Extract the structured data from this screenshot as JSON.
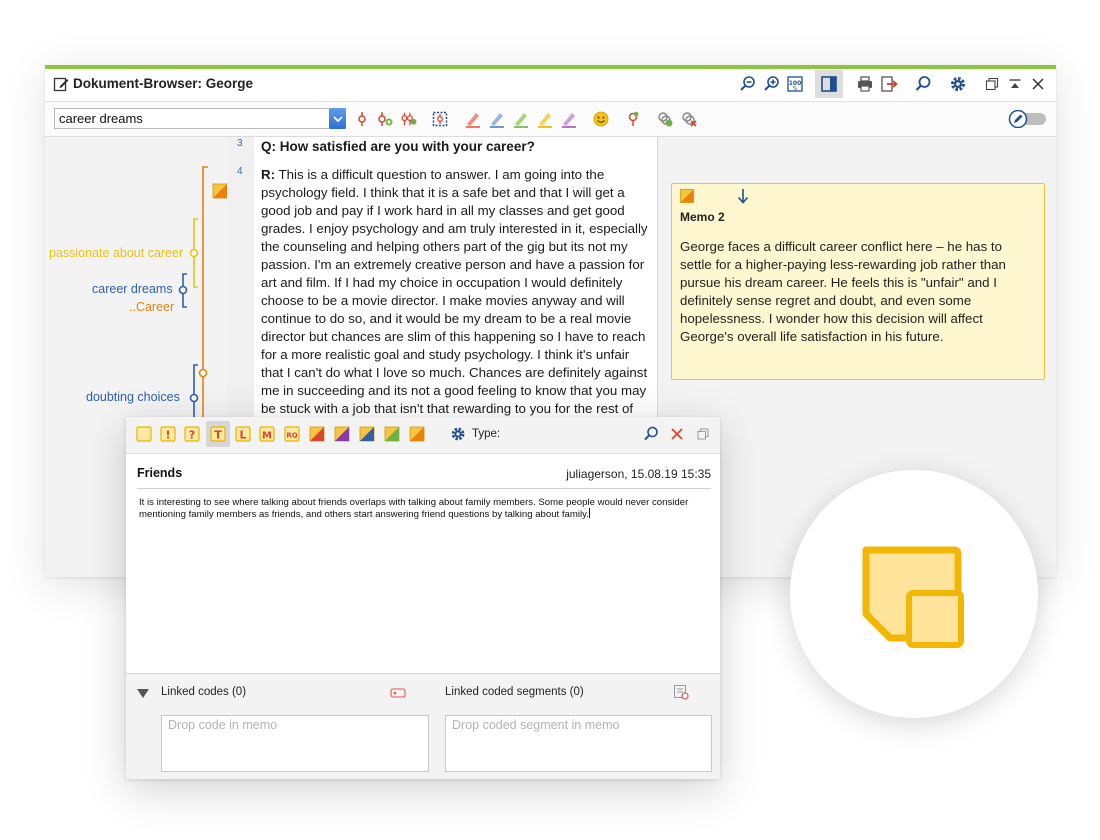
{
  "window": {
    "title": "Dokument-Browser: George",
    "toolbar_icons": [
      "zoom-out-icon",
      "zoom-in-icon",
      "zoom-100-icon",
      "panel-toggle-icon",
      "print-icon",
      "export-icon",
      "search-icon",
      "settings-icon",
      "restore-icon",
      "collapse-icon",
      "close-icon"
    ],
    "accent": "#8cc63f"
  },
  "toolbar": {
    "code_selector_value": "career dreams",
    "icons": [
      "code-icon",
      "code-add-icon",
      "code-multi-icon",
      "select-region-icon",
      "highlight-red-icon",
      "highlight-blue-icon",
      "highlight-green-icon",
      "highlight-yellow-icon",
      "highlight-purple-icon",
      "emoticode-icon",
      "pin-code-icon",
      "link-add-icon",
      "link-remove-icon",
      "edit-mode-toggle"
    ]
  },
  "code_strip": {
    "labels": [
      {
        "text": "passionate about career",
        "color": "#e8c21a"
      },
      {
        "text": "career dreams",
        "color": "#2e5fa8"
      },
      {
        "text": "..Career",
        "color": "#e8820c"
      },
      {
        "text": "doubting choices",
        "color": "#2e5fa8"
      }
    ]
  },
  "document": {
    "line3": "3",
    "line4": "4",
    "question": "Q: How satisfied are you with your career?",
    "response_prefix": "R:",
    "response_text": "This is a difficult question to answer. I am going into the psychology field. I think that it is a safe bet and that I will get a good job and pay if I work hard in all my classes and get good grades. I enjoy psychology and am truly interested in it, especially the counseling and helping others part of the gig but its not my passion. I'm an extremely creative person and have a passion for art and film. If I had my choice in occupation I would definitely choose to be a movie director. I make movies anyway and will continue to do so, and it would be my dream to be a real movie director but chances are slim of this happening so I have to reach for a more realistic goal and study psychology. I think it's unfair that I can't do what I love so much. Chances are definitely against me in succeeding and its not a good feeling to know that you may be stuck with a job that isn't that rewarding to you for the rest of"
  },
  "memo": {
    "title": "Memo 2",
    "text": "George faces a difficult career conflict here – he has to settle for a higher-paying less-rewarding job rather than pursue his dream career. He feels this is \"unfair\" and I definitely sense regret and doubt, and even some hopelessness. I wonder how this decision will affect George's overall life satisfaction in his future.",
    "bg": "#fff7cf",
    "border": "#f1c232"
  },
  "memo_editor": {
    "memo_types": [
      "memo-plain",
      "memo-exclamation",
      "memo-question",
      "memo-T",
      "memo-L",
      "memo-M",
      "memo-RQ",
      "memo-color-1",
      "memo-color-2",
      "memo-color-3",
      "memo-color-4",
      "memo-color-5"
    ],
    "type_label": "Type:",
    "title": "Friends",
    "meta": "juliagerson, 15.08.19 15:35",
    "body": "It is interesting to see where talking about friends overlaps with talking about family members. Some people would never consider mentioning family members as friends, and others start answering friend questions by talking about family.",
    "linked_codes_label": "Linked codes (0)",
    "linked_segments_label": "Linked coded segments (0)",
    "drop_code_placeholder": "Drop code in memo",
    "drop_segment_placeholder": "Drop coded segment in memo"
  }
}
